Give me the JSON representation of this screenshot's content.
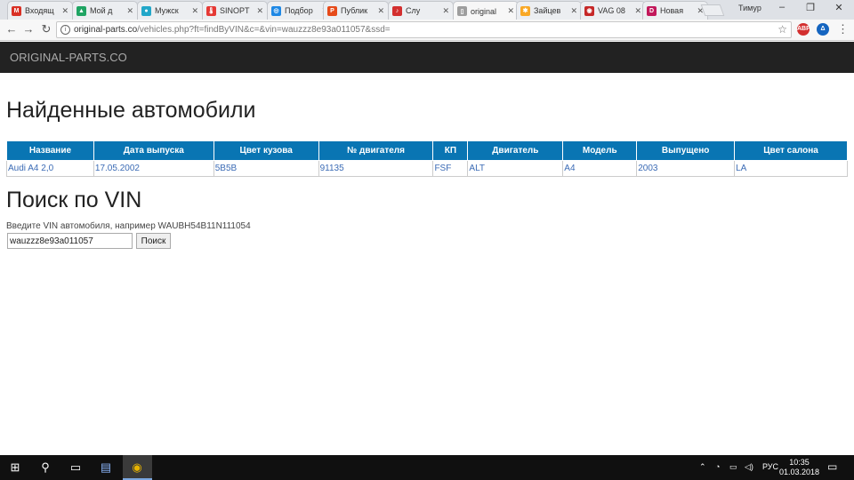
{
  "browser": {
    "tabs": [
      {
        "label": "Входящ",
        "icon": "gmail-icon",
        "color": "#d93025",
        "glyph": "M"
      },
      {
        "label": "Мой д",
        "icon": "drive-icon",
        "color": "#1fa463",
        "glyph": "▲"
      },
      {
        "label": "Мужск",
        "icon": "site-icon",
        "color": "#22a7c9",
        "glyph": "●"
      },
      {
        "label": "SINOPT",
        "icon": "thermometer-icon",
        "color": "#e53935",
        "glyph": "🌡"
      },
      {
        "label": "Подбор",
        "icon": "target-icon",
        "color": "#1e88e5",
        "glyph": "◎"
      },
      {
        "label": "Публик",
        "icon": "publication-icon",
        "color": "#e64a19",
        "glyph": "P"
      },
      {
        "label": "Слу",
        "icon": "music-icon",
        "color": "#d32f2f",
        "glyph": "♪"
      },
      {
        "label": "original",
        "icon": "page-icon",
        "color": "#9e9e9e",
        "glyph": "▯"
      },
      {
        "label": "Зайцев",
        "icon": "gear-icon",
        "color": "#f9a825",
        "glyph": "✱"
      },
      {
        "label": "VAG 08",
        "icon": "globe-icon",
        "color": "#c62828",
        "glyph": "◉"
      },
      {
        "label": "Новая",
        "icon": "drom-icon",
        "color": "#c2185b",
        "glyph": "D"
      }
    ],
    "user_name": "Тимур",
    "window_controls": {
      "minimize": "–",
      "restore": "❐",
      "close": "✕"
    },
    "url_host": "original-parts.co",
    "url_path": "/vehicles.php?ft=findByVIN&c=&vin=wauzzz8e93a011057&ssd=",
    "extensions": [
      {
        "name": "adblock-icon",
        "label": "ABP",
        "color": "#d32f2f"
      },
      {
        "name": "delta-icon",
        "label": "Δ",
        "color": "#1565c0"
      }
    ]
  },
  "site": {
    "brand": "ORIGINAL-PARTS.CO"
  },
  "main": {
    "found_title": "Найденные автомобили",
    "table": {
      "columns": [
        "Название",
        "Дата выпуска",
        "Цвет кузова",
        "№ двигателя",
        "КП",
        "Двигатель",
        "Модель",
        "Выпущено",
        "Цвет салона"
      ],
      "rows": [
        [
          "Audi A4 2,0",
          "17.05.2002",
          "5B5B",
          "91135",
          "FSF",
          "ALT",
          "A4",
          "2003",
          "LA"
        ]
      ]
    },
    "vin_title": "Поиск по VIN",
    "vin_hint": "Введите VIN автомобиля, например WAUBH54B11N111054",
    "vin_value": "wauzzz8e93a011057",
    "search_button": "Поиск"
  },
  "taskbar": {
    "language": "РУС",
    "time": "10:35",
    "date": "01.03.2018"
  },
  "colors": {
    "table_header": "#0975b3",
    "link": "#3b6bb5",
    "site_header": "#222222"
  }
}
